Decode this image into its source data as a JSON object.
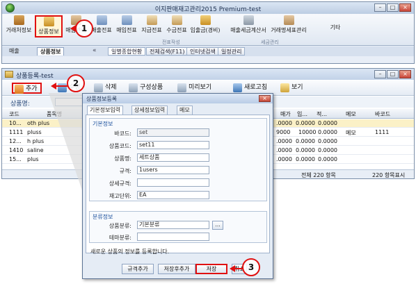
{
  "app": {
    "title": "이지판매재고관리2015 Premium-test",
    "window_buttons": [
      "–",
      "□",
      "×"
    ]
  },
  "ribbon": {
    "buttons": [
      {
        "label": "거래처정보",
        "icon": "people-icon"
      },
      {
        "label": "상품정보",
        "icon": "product-icon"
      },
      {
        "label": "매입관리",
        "icon": "purchase-icon"
      },
      {
        "label": "매출전표",
        "icon": "sales-slip-icon"
      },
      {
        "label": "매입전표",
        "icon": "purchase-slip-icon"
      },
      {
        "label": "지급전표",
        "icon": "payment-slip-icon"
      },
      {
        "label": "수금전표",
        "icon": "collection-slip-icon"
      },
      {
        "label": "입출금(경비)",
        "icon": "cash-icon"
      },
      {
        "label": "매출세금계산서",
        "icon": "tax-invoice-icon"
      },
      {
        "label": "거래명세표관리",
        "icon": "statement-icon"
      },
      {
        "label": "기타",
        "icon": "more-icon"
      }
    ],
    "groups": [
      "전표작성",
      "세금관리"
    ]
  },
  "panel_tabs": {
    "left_tab": "매출",
    "active_tab": "상품정보",
    "collapse": "«",
    "doc_tabs": [
      "일별종합현황",
      "전체검색(F11)",
      "인터넷검색",
      "일정관리"
    ]
  },
  "list_window": {
    "title": "상품등록-test",
    "toolbar": {
      "add": "추가",
      "edit": "수정",
      "del": "삭제",
      "copy": "구성상품",
      "preview": "미리보기",
      "refresh": "새로고침",
      "view": "보기"
    },
    "search_label": "상품명:",
    "columns": [
      "코드",
      "품목명",
      "매가",
      "입...",
      "적...",
      "메모",
      "바코드"
    ],
    "rows": [
      {
        "code": "10...",
        "name": "oth plus",
        "price": ".0000",
        "in": "0.0000",
        "stock": "0.0000",
        "memo": "",
        "barcode": ""
      },
      {
        "code": "1111",
        "name": "pluss",
        "price": "9000",
        "in": "10000",
        "stock": "0.0000",
        "memo": "메모",
        "barcode": "1111"
      },
      {
        "code": "12...",
        "name": "h plus",
        "price": ".0000",
        "in": "0.0000",
        "stock": "0.0000",
        "memo": "",
        "barcode": ""
      },
      {
        "code": "1410",
        "name": "saline",
        "price": ".0000",
        "in": "0.0000",
        "stock": "0.0000",
        "memo": "",
        "barcode": ""
      },
      {
        "code": "15...",
        "name": "plus",
        "price": ".0000",
        "in": "0.0000",
        "stock": "0.0000",
        "memo": "",
        "barcode": ""
      }
    ],
    "footer_total": "전체 220 항목",
    "footer_shown": "220 항목표시"
  },
  "dialog": {
    "title": "상품정보등록",
    "close": "×",
    "tabs": [
      "기본정보입력",
      "상세정보입력",
      "메모"
    ],
    "section_basic": "기본정보",
    "fields_basic": [
      {
        "label": "바코드:",
        "value": "set",
        "readonly": true
      },
      {
        "label": "상품코드:",
        "value": "set11"
      },
      {
        "label": "상품명:",
        "value": "세트상품"
      },
      {
        "label": "규격:",
        "value": "1users"
      },
      {
        "label": "상세규격:",
        "value": ""
      },
      {
        "label": "재고단위:",
        "value": "EA"
      }
    ],
    "section_category": "분류정보",
    "fields_category": [
      {
        "label": "상품분류:",
        "value": "기본분류"
      },
      {
        "label": "테마분류:",
        "value": ""
      }
    ],
    "dots": "...",
    "status": "새로운 상품의 정보를 등록합니다.",
    "buttons": {
      "spec_add": "규격추가",
      "save_add": "저장후추가",
      "save": "저장",
      "close": "취소"
    }
  },
  "callouts": [
    "1",
    "2",
    "3"
  ]
}
